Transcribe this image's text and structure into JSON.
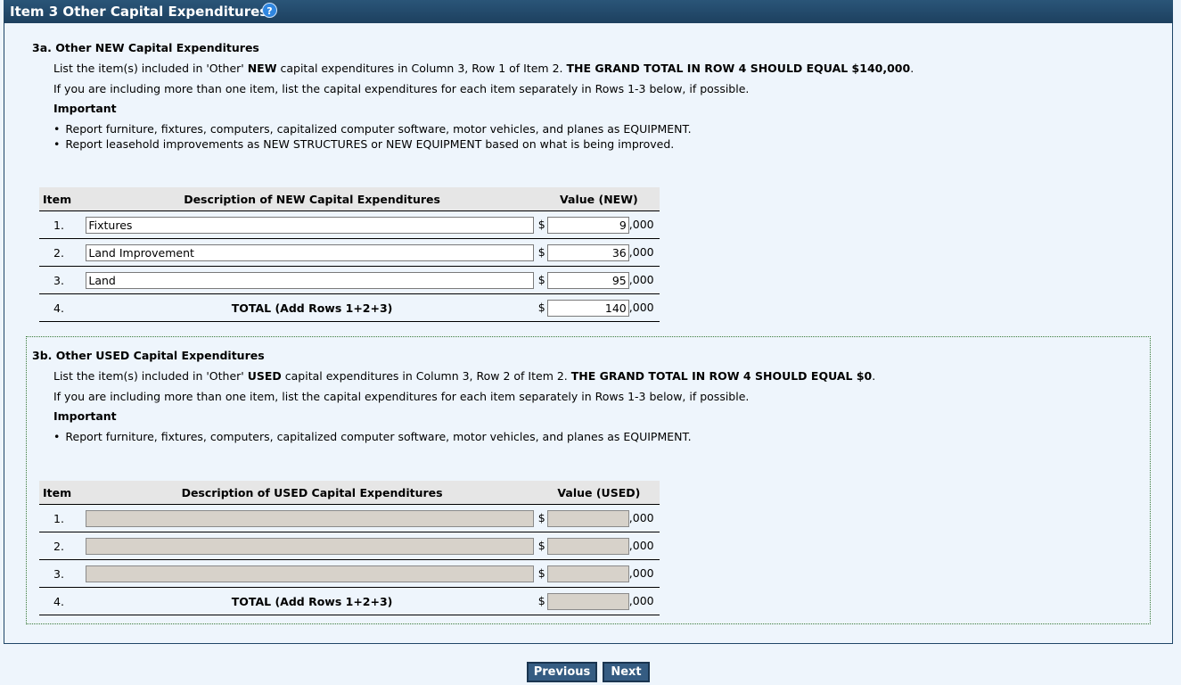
{
  "header": {
    "title": "Item 3 Other Capital Expenditures",
    "help_icon": "?"
  },
  "section_a": {
    "title": "3a. Other NEW Capital Expenditures",
    "instr1_pre": "List the item(s) included in 'Other' ",
    "instr1_bold1": "NEW",
    "instr1_mid": " capital expenditures in Column 3, Row 1 of Item 2. ",
    "instr1_bold2": "THE GRAND TOTAL IN ROW 4 SHOULD EQUAL $140,000",
    "instr1_end": ".",
    "instr2": "If you are including more than one item, list the capital expenditures for each item separately in Rows 1-3 below, if possible.",
    "important": "Important",
    "bullets": [
      "Report furniture, fixtures, computers, capitalized computer software, motor vehicles, and planes as EQUIPMENT.",
      "Report leasehold improvements as NEW STRUCTURES or NEW EQUIPMENT based on what is being improved."
    ],
    "table": {
      "headers": {
        "item": "Item",
        "desc": "Description of NEW Capital Expenditures",
        "value": "Value (NEW)"
      },
      "rows": [
        {
          "num": "1.",
          "desc": "Fixtures",
          "value": "9"
        },
        {
          "num": "2.",
          "desc": "Land Improvement",
          "value": "36"
        },
        {
          "num": "3.",
          "desc": "Land",
          "value": "95"
        }
      ],
      "total": {
        "num": "4.",
        "label": "TOTAL (Add Rows 1+2+3)",
        "value": "140"
      },
      "currency": "$",
      "suffix": ",000"
    }
  },
  "section_b": {
    "title": "3b. Other USED Capital Expenditures",
    "instr1_pre": "List the item(s) included in 'Other' ",
    "instr1_bold1": "USED",
    "instr1_mid": " capital expenditures in Column 3, Row 2 of Item 2. ",
    "instr1_bold2": "THE GRAND TOTAL IN ROW 4 SHOULD EQUAL $0",
    "instr1_end": ".",
    "instr2": "If you are including more than one item, list the capital expenditures for each item separately in Rows 1-3 below, if possible.",
    "important": "Important",
    "bullets": [
      "Report furniture, fixtures, computers, capitalized computer software, motor vehicles, and planes as EQUIPMENT."
    ],
    "table": {
      "headers": {
        "item": "Item",
        "desc": "Description of USED Capital Expenditures",
        "value": "Value (USED)"
      },
      "rows": [
        {
          "num": "1.",
          "desc": "",
          "value": ""
        },
        {
          "num": "2.",
          "desc": "",
          "value": ""
        },
        {
          "num": "3.",
          "desc": "",
          "value": ""
        }
      ],
      "total": {
        "num": "4.",
        "label": "TOTAL (Add Rows 1+2+3)",
        "value": ""
      },
      "currency": "$",
      "suffix": ",000"
    }
  },
  "nav": {
    "previous": "Previous",
    "next": "Next"
  }
}
